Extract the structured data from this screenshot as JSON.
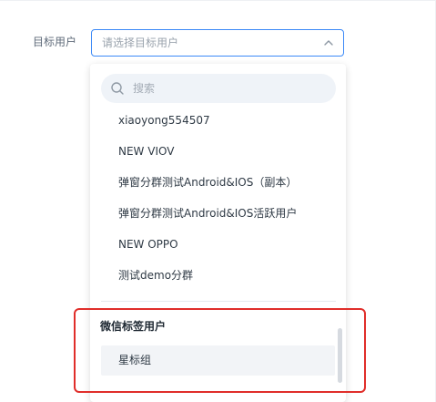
{
  "form": {
    "label": "目标用户",
    "select_placeholder": "请选择目标用户"
  },
  "dropdown": {
    "search_placeholder": "搜索",
    "options": [
      "xiaoyong554507",
      "NEW VIOV",
      "弹窗分群测试Android&IOS（副本）",
      "弹窗分群测试Android&IOS活跃用户",
      "NEW OPPO",
      "测试demo分群"
    ],
    "group": {
      "title": "微信标签用户",
      "options": [
        "星标组"
      ]
    }
  },
  "colors": {
    "focus_border": "#3d8af7",
    "callout_border": "#e02e2a",
    "hover_background": "#f2f4f7"
  },
  "icons": {
    "select_arrow": "chevron-up-icon",
    "search": "search-icon"
  }
}
